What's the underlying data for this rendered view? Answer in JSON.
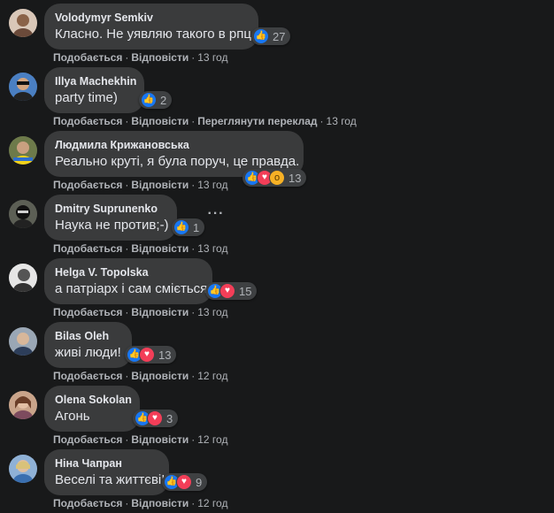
{
  "comments": [
    {
      "author": "Volodymyr Semkiv",
      "text": "Класно. Не уявляю такого в рпц",
      "reactions": [
        "like"
      ],
      "count": "27",
      "like": "Подобається",
      "reply": "Відповісти",
      "time": "13 год"
    },
    {
      "author": "Illya Machekhin",
      "text": "party time)",
      "reactions": [
        "like"
      ],
      "count": "2",
      "like": "Подобається",
      "reply": "Відповісти",
      "translate": "Переглянути переклад",
      "time": "13 год"
    },
    {
      "author": "Людмила Крижановська",
      "text": "Реально круті, я була поруч, це правда.",
      "reactions": [
        "like",
        "love",
        "wow"
      ],
      "count": "13",
      "like": "Подобається",
      "reply": "Відповісти",
      "time": "13 год"
    },
    {
      "author": "Dmitry Suprunenko",
      "text": "Наука не против;-)",
      "reactions": [
        "like"
      ],
      "count": "1",
      "like": "Подобається",
      "reply": "Відповісти",
      "time": "13 год",
      "more": "···"
    },
    {
      "author": "Helga V. Topolska",
      "text": "а патріарх і сам сміється",
      "reactions": [
        "like",
        "love"
      ],
      "count": "15",
      "like": "Подобається",
      "reply": "Відповісти",
      "time": "13 год"
    },
    {
      "author": "Bilas Oleh",
      "text": "живі люди!",
      "reactions": [
        "like",
        "love"
      ],
      "count": "13",
      "like": "Подобається",
      "reply": "Відповісти",
      "time": "12 год"
    },
    {
      "author": "Olena Sokolan",
      "text": "Агонь",
      "reactions": [
        "like",
        "love"
      ],
      "count": "3",
      "like": "Подобається",
      "reply": "Відповісти",
      "time": "12 год"
    },
    {
      "author": "Ніна Чапран",
      "text": "Веселі та життєві!",
      "reactions": [
        "like",
        "love"
      ],
      "count": "9",
      "like": "Подобається",
      "reply": "Відповісти",
      "time": "12 год"
    }
  ],
  "icons": {
    "like": "thumbs-up-icon",
    "love": "heart-icon",
    "wow": "wow-icon"
  },
  "colors": {
    "background": "#18191a",
    "bubble": "#3a3b3c",
    "like": "#1877f2",
    "love": "#f33e58",
    "wow": "#f7b125",
    "meta": "#b0b3b8"
  }
}
